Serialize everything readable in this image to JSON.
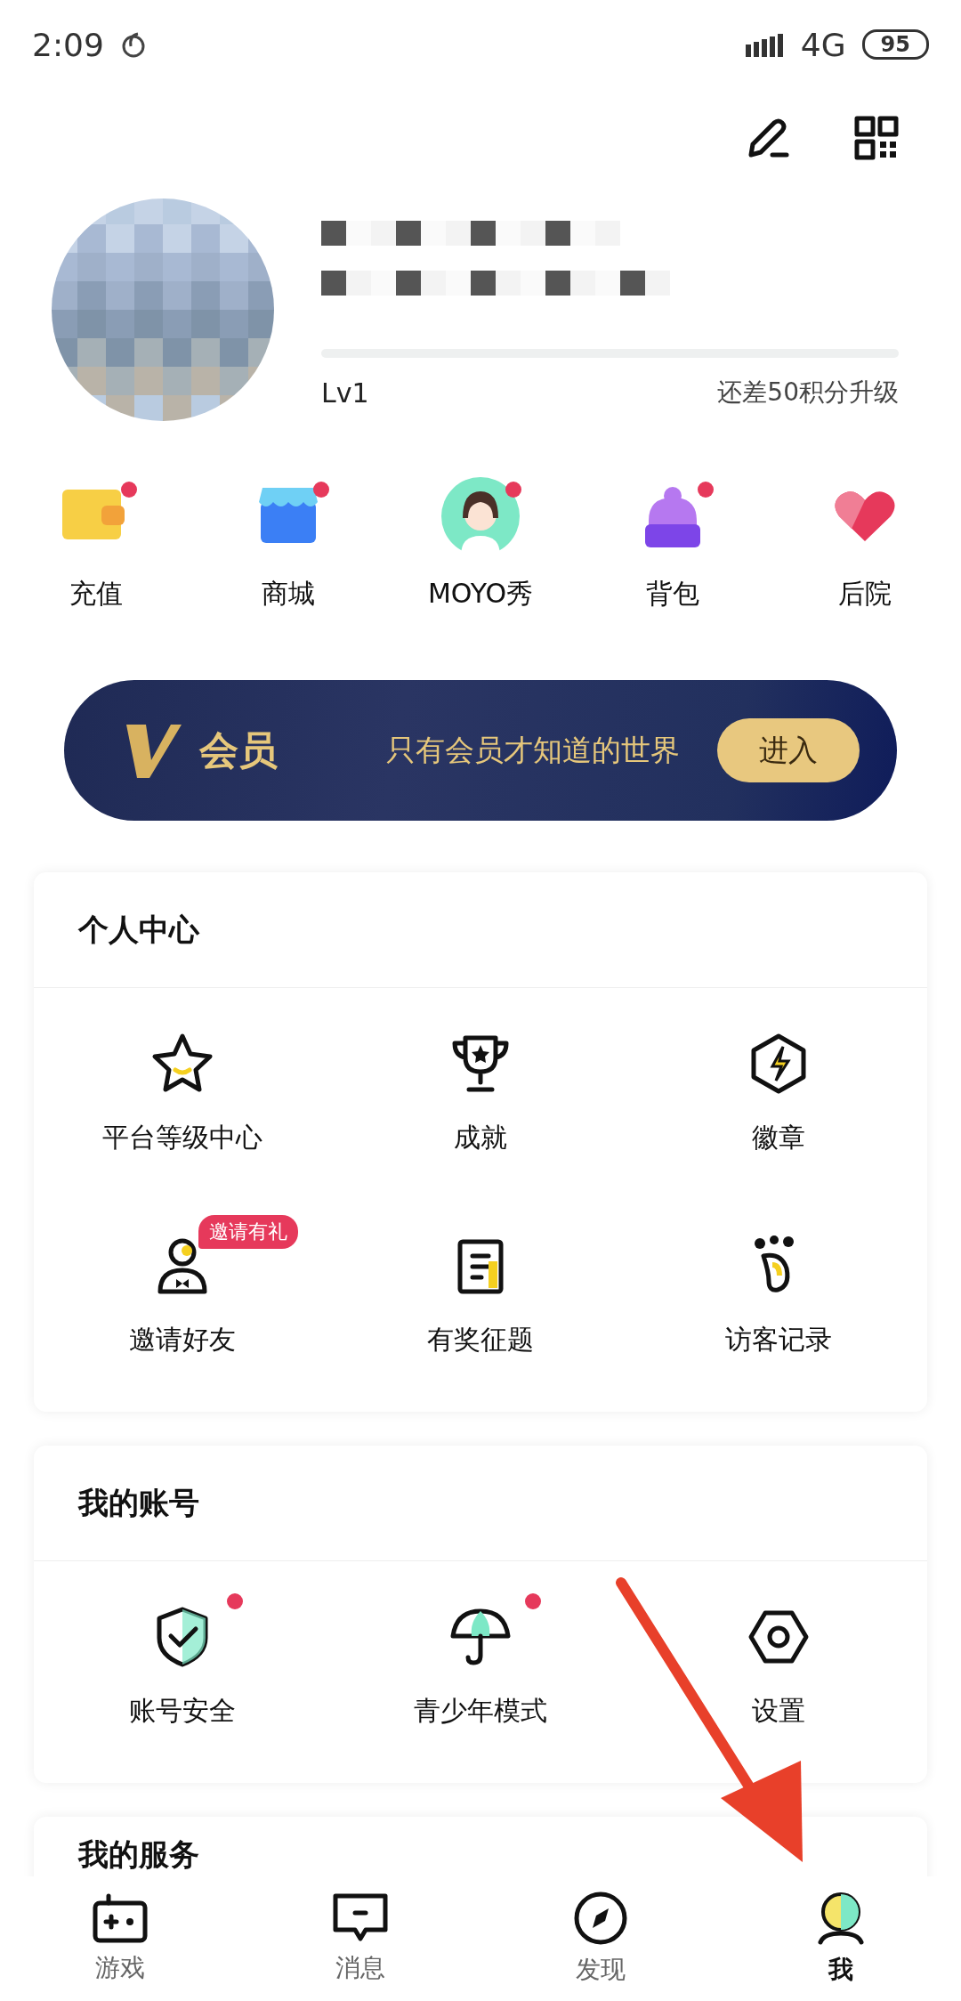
{
  "status_bar": {
    "time": "2:09",
    "network": "4G",
    "battery": "95"
  },
  "profile": {
    "level_label": "Lv1",
    "upgrade_hint": "还差50积分升级"
  },
  "shortcuts": [
    {
      "label": "充值",
      "dot": true
    },
    {
      "label": "商城",
      "dot": true
    },
    {
      "label": "MOYO秀",
      "dot": true
    },
    {
      "label": "背包",
      "dot": true
    },
    {
      "label": "后院",
      "dot": false
    }
  ],
  "vip_banner": {
    "title": "会员",
    "slogan": "只有会员才知道的世界",
    "button": "进入"
  },
  "sections": [
    {
      "title": "个人中心",
      "items": [
        {
          "label": "平台等级中心",
          "dot": false
        },
        {
          "label": "成就",
          "dot": false
        },
        {
          "label": "徽章",
          "dot": false
        },
        {
          "label": "邀请好友",
          "dot": false,
          "tag": "邀请有礼"
        },
        {
          "label": "有奖征题",
          "dot": false
        },
        {
          "label": "访客记录",
          "dot": false
        }
      ]
    },
    {
      "title": "我的账号",
      "items": [
        {
          "label": "账号安全",
          "dot": true
        },
        {
          "label": "青少年模式",
          "dot": true
        },
        {
          "label": "设置",
          "dot": false
        }
      ]
    },
    {
      "title": "我的服务"
    }
  ],
  "bottom_nav": [
    {
      "label": "游戏",
      "selected": false
    },
    {
      "label": "消息",
      "selected": false
    },
    {
      "label": "发现",
      "selected": false
    },
    {
      "label": "我",
      "selected": true
    }
  ]
}
